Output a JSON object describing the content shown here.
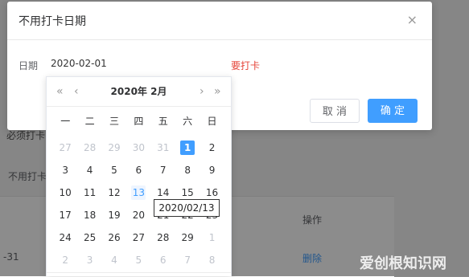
{
  "background": {
    "frag_1": "必须打卡",
    "frag_2": "不用打卡",
    "table_header_action": "操作",
    "row_date_tail": "-31",
    "row_delete": "删除"
  },
  "dialog": {
    "title": "不用打卡日期",
    "close": "×",
    "label_date": "日期",
    "date_value": "2020-02-01",
    "need_text": "需要打卡",
    "cancel": "取 消",
    "confirm": "确 定"
  },
  "calendar": {
    "title": "2020年 2月",
    "prev_year": "«",
    "prev_month": "‹",
    "next_month": "›",
    "next_year": "»",
    "weekdays": [
      "一",
      "二",
      "三",
      "四",
      "五",
      "六",
      "日"
    ],
    "weeks": [
      [
        {
          "d": "27",
          "m": true
        },
        {
          "d": "28",
          "m": true
        },
        {
          "d": "29",
          "m": true
        },
        {
          "d": "30",
          "m": true
        },
        {
          "d": "31",
          "m": true
        },
        {
          "d": "1",
          "sel": true
        },
        {
          "d": "2"
        }
      ],
      [
        {
          "d": "3"
        },
        {
          "d": "4"
        },
        {
          "d": "5"
        },
        {
          "d": "6"
        },
        {
          "d": "7"
        },
        {
          "d": "8"
        },
        {
          "d": "9"
        }
      ],
      [
        {
          "d": "10"
        },
        {
          "d": "11"
        },
        {
          "d": "12"
        },
        {
          "d": "13",
          "today": true
        },
        {
          "d": "14"
        },
        {
          "d": "15"
        },
        {
          "d": "16"
        }
      ],
      [
        {
          "d": "17"
        },
        {
          "d": "18"
        },
        {
          "d": "19"
        },
        {
          "d": "20"
        },
        {
          "d": "21"
        },
        {
          "d": "22"
        },
        {
          "d": "23"
        }
      ],
      [
        {
          "d": "24"
        },
        {
          "d": "25"
        },
        {
          "d": "26"
        },
        {
          "d": "27"
        },
        {
          "d": "28"
        },
        {
          "d": "29"
        },
        {
          "d": "1",
          "m": true
        }
      ],
      [
        {
          "d": "2",
          "m": true
        },
        {
          "d": "3",
          "m": true
        },
        {
          "d": "4",
          "m": true
        },
        {
          "d": "5",
          "m": true
        },
        {
          "d": "6",
          "m": true
        },
        {
          "d": "7",
          "m": true
        },
        {
          "d": "8",
          "m": true
        }
      ]
    ],
    "hover_tip": "2020/02/13"
  },
  "watermark": "爱创根知识网"
}
